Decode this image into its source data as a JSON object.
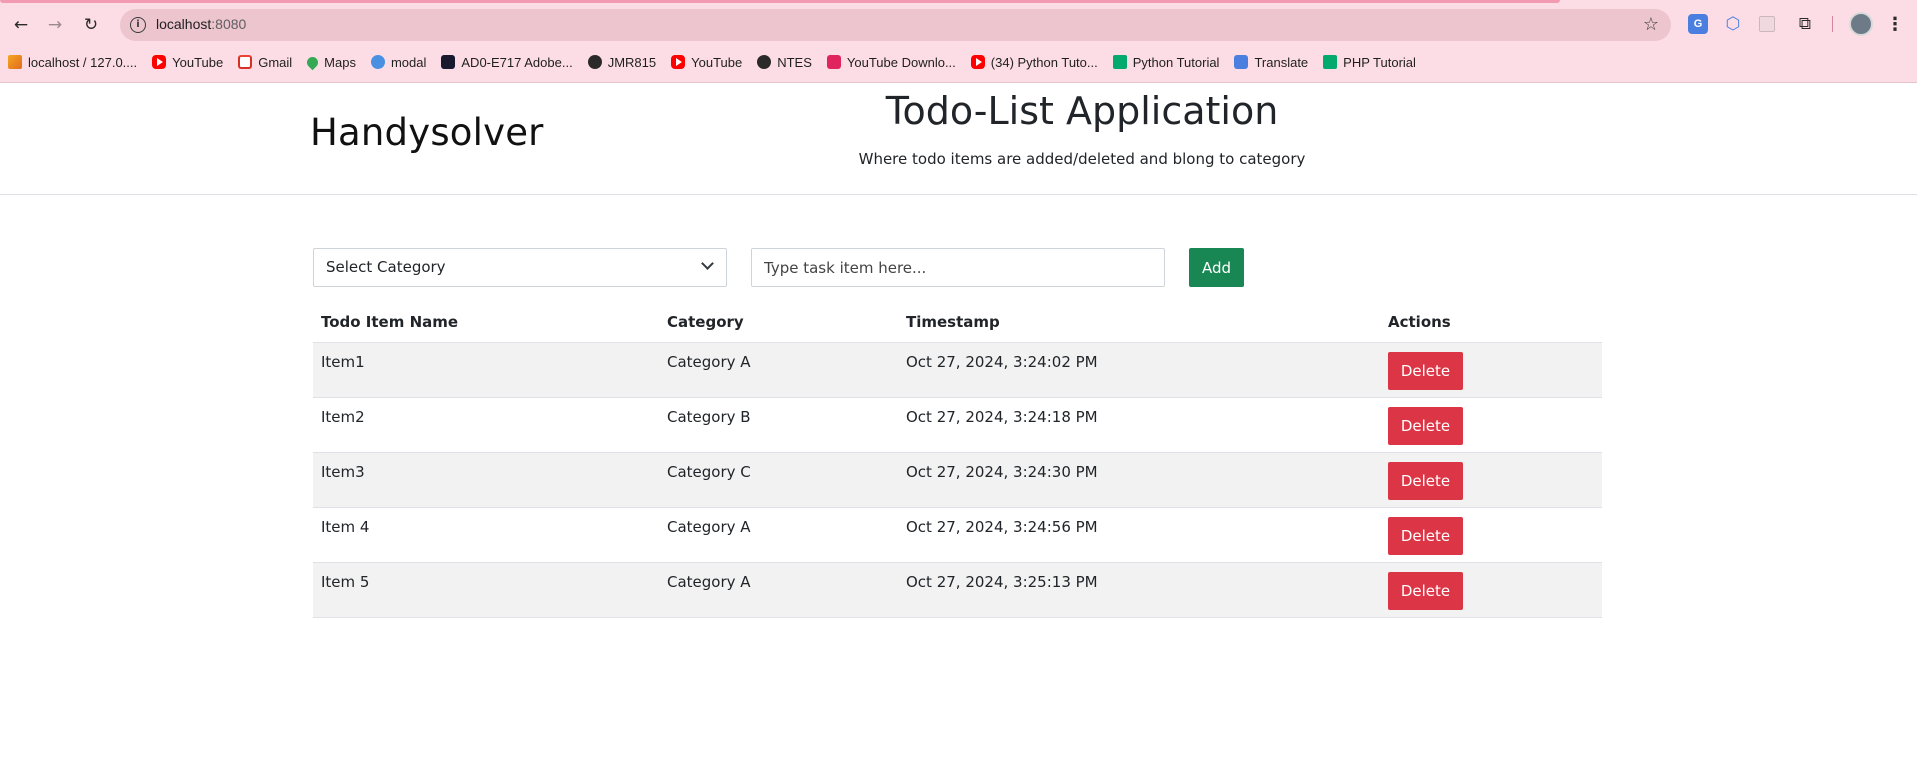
{
  "browser": {
    "url_host": "localhost",
    "url_port": ":8080",
    "bookmarks": [
      {
        "label": "localhost / 127.0....",
        "icon": "xampp-icon"
      },
      {
        "label": "YouTube",
        "icon": "youtube-icon"
      },
      {
        "label": "Gmail",
        "icon": "gmail-icon"
      },
      {
        "label": "Maps",
        "icon": "maps-icon"
      },
      {
        "label": "modal",
        "icon": "modal-icon"
      },
      {
        "label": "AD0-E717 Adobe...",
        "icon": "adobe-icon"
      },
      {
        "label": "JMR815",
        "icon": "globe-icon"
      },
      {
        "label": "YouTube",
        "icon": "youtube-icon"
      },
      {
        "label": "NTES",
        "icon": "globe-icon"
      },
      {
        "label": "YouTube Downlo...",
        "icon": "download-icon"
      },
      {
        "label": "(34) Python Tuto...",
        "icon": "youtube-icon"
      },
      {
        "label": "Python Tutorial",
        "icon": "w3schools-icon"
      },
      {
        "label": "Translate",
        "icon": "translate-icon"
      },
      {
        "label": "PHP Tutorial",
        "icon": "w3schools-icon"
      }
    ]
  },
  "header": {
    "brand": "Handysolver",
    "title": "Todo-List Application",
    "subtitle": "Where todo items are added/deleted and blong to category"
  },
  "form": {
    "category_select": "Select Category",
    "task_placeholder": "Type task item here...",
    "add_label": "Add"
  },
  "table": {
    "headers": [
      "Todo Item Name",
      "Category",
      "Timestamp",
      "Actions"
    ],
    "delete_label": "Delete",
    "rows": [
      {
        "name": "Item1",
        "category": "Category A",
        "timestamp": "Oct 27, 2024, 3:24:02 PM"
      },
      {
        "name": "Item2",
        "category": "Category B",
        "timestamp": "Oct 27, 2024, 3:24:18 PM"
      },
      {
        "name": "Item3",
        "category": "Category C",
        "timestamp": "Oct 27, 2024, 3:24:30 PM"
      },
      {
        "name": "Item 4",
        "category": "Category A",
        "timestamp": "Oct 27, 2024, 3:24:56 PM"
      },
      {
        "name": "Item 5",
        "category": "Category A",
        "timestamp": "Oct 27, 2024, 3:25:13 PM"
      }
    ]
  }
}
